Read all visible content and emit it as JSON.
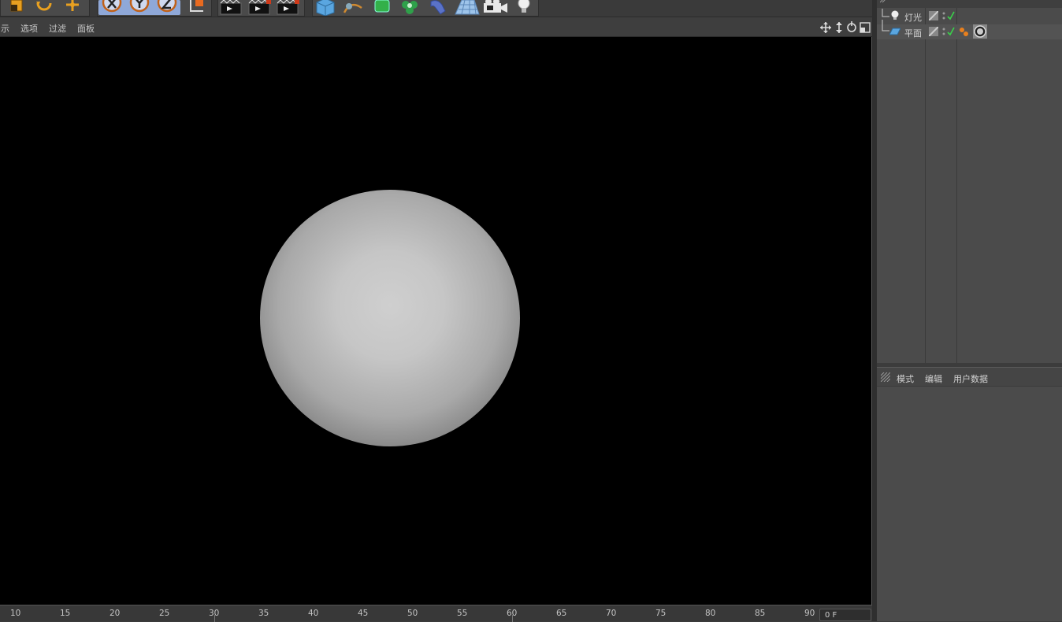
{
  "viewport_menu": [
    "示",
    "选项",
    "过滤",
    "面板"
  ],
  "objects": [
    {
      "name": "灯光",
      "icon": "light-icon"
    },
    {
      "name": "平面",
      "icon": "plane-icon"
    }
  ],
  "attributes_menu": [
    "模式",
    "编辑",
    "用户数据"
  ],
  "timeline": {
    "ticks": [
      "10",
      "15",
      "20",
      "25",
      "30",
      "35",
      "40",
      "45",
      "50",
      "55",
      "60",
      "65",
      "70",
      "75",
      "80",
      "85",
      "90"
    ],
    "frame_value": "0 F"
  },
  "colors": {
    "accent": "#f0a020",
    "viewport_bg": "#000000"
  }
}
